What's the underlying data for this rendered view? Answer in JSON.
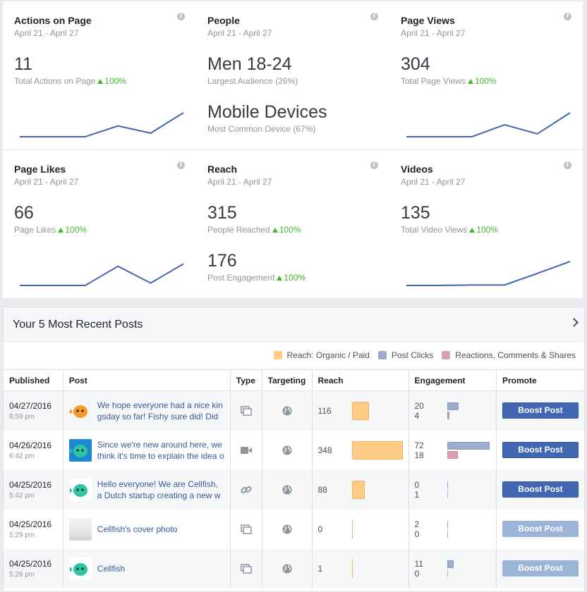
{
  "summary": {
    "cards": [
      {
        "title": "Actions on Page",
        "date": "April 21 - April 27",
        "value": "11",
        "label": "Total Actions on Page",
        "change": "100%",
        "spark": [
          0,
          0,
          0,
          0.45,
          0.15,
          1
        ]
      },
      {
        "title": "People",
        "date": "April 21 - April 27",
        "value": "Men 18-24",
        "label": "Largest Audience (26%)",
        "value2": "Mobile Devices",
        "label2": "Most Common Device (67%)"
      },
      {
        "title": "Page Views",
        "date": "April 21 - April 27",
        "value": "304",
        "label": "Total Page Views",
        "change": "100%",
        "spark": [
          0,
          0,
          0,
          0.5,
          0.12,
          1
        ]
      },
      {
        "title": "Page Likes",
        "date": "April 21 - April 27",
        "value": "66",
        "label": "Page Likes",
        "change": "100%",
        "spark": [
          0,
          0,
          0,
          0.8,
          0.1,
          0.9
        ]
      },
      {
        "title": "Reach",
        "date": "April 21 - April 27",
        "value": "315",
        "label": "People Reached",
        "change": "100%",
        "value2": "176",
        "label2": "Post Engagement",
        "change2": "100%"
      },
      {
        "title": "Videos",
        "date": "April 21 - April 27",
        "value": "135",
        "label": "Total Video Views",
        "change": "100%",
        "spark": [
          0,
          0,
          0.02,
          0.02,
          0.5,
          1
        ]
      }
    ]
  },
  "posts_panel": {
    "title": "Your 5 Most Recent Posts",
    "legend": [
      {
        "label": "Reach: Organic / Paid",
        "color": "#ffcc88"
      },
      {
        "label": "Post Clicks",
        "color": "#9daccb"
      },
      {
        "label": "Reactions, Comments & Shares",
        "color": "#d8a1b2"
      }
    ],
    "columns": [
      "Published",
      "Post",
      "Type",
      "Targeting",
      "Reach",
      "Engagement",
      "Promote"
    ],
    "rows": [
      {
        "date": "04/27/2016",
        "time": "8:59 pm",
        "thumb": "fish-orange",
        "text1": "We hope everyone had a nice kin",
        "text2": "gsday so far! Fishy sure did! Did",
        "type": "album-icon",
        "reach": 116,
        "clicks": 20,
        "reactions": 4,
        "boost": "Boost Post",
        "boost_enabled": true
      },
      {
        "date": "04/26/2016",
        "time": "6:42 pm",
        "thumb": "fish-blue",
        "text1": "Since we're new around here, we",
        "text2": "think it's time to explain the idea o",
        "type": "video-icon",
        "reach": 348,
        "clicks": 72,
        "reactions": 18,
        "boost": "Boost Post",
        "boost_enabled": true
      },
      {
        "date": "04/25/2016",
        "time": "5:42 pm",
        "thumb": "fish-green",
        "text1": "Hello everyone! We are Cellfish,",
        "text2": "a Dutch startup creating a new w",
        "type": "link-icon",
        "reach": 88,
        "clicks": 0,
        "reactions": 1,
        "boost": "Boost Post",
        "boost_enabled": true
      },
      {
        "date": "04/25/2016",
        "time": "5:29 pm",
        "thumb": "cover",
        "text1": "Cellfish's cover photo",
        "text2": "",
        "type": "album-icon",
        "reach": 0,
        "clicks": 2,
        "reactions": 0,
        "boost": "Boost Post",
        "boost_enabled": false
      },
      {
        "date": "04/25/2016",
        "time": "5:26 pm",
        "thumb": "fish-green",
        "text1": "Cellfish",
        "text2": "",
        "type": "album-icon",
        "reach": 1,
        "clicks": 11,
        "reactions": 0,
        "boost": "Boost Post",
        "boost_enabled": false
      }
    ]
  }
}
